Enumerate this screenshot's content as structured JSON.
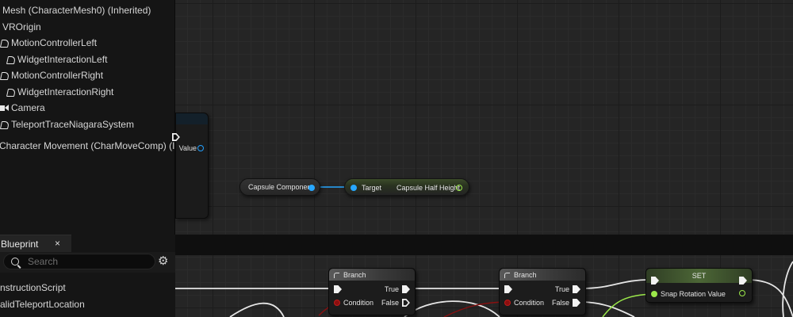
{
  "components": [
    {
      "label": "Mesh (CharacterMesh0) (Inherited)",
      "icon": "none"
    },
    {
      "label": "VROrigin",
      "icon": "none"
    },
    {
      "label": "MotionControllerLeft",
      "icon": "motion-controller-icon"
    },
    {
      "label": "WidgetInteractionLeft",
      "icon": "widget-interaction-icon"
    },
    {
      "label": "MotionControllerRight",
      "icon": "motion-controller-icon"
    },
    {
      "label": "WidgetInteractionRight",
      "icon": "widget-interaction-icon"
    },
    {
      "label": "Camera",
      "icon": "camera-icon"
    },
    {
      "label": "TeleportTraceNiagaraSystem",
      "icon": "niagara-icon"
    },
    {
      "label": "Character Movement (CharMoveComp) (Inh",
      "icon": "none"
    }
  ],
  "graph": {
    "partial_node": {
      "value_label": "Value"
    },
    "capsule_node": {
      "label": "Capsule Component"
    },
    "half_height_node": {
      "target_label": "Target",
      "output_label": "Capsule Half Height"
    },
    "branch_1": {
      "title": "Branch",
      "condition_label": "Condition",
      "true_label": "True",
      "false_label": "False"
    },
    "branch_2": {
      "title": "Branch",
      "condition_label": "Condition",
      "true_label": "True",
      "false_label": "False"
    },
    "set_node": {
      "title": "SET",
      "value_label": "Snap Rotation Value"
    }
  },
  "my_blueprint": {
    "tab_label": "Blueprint",
    "close_label": "×",
    "search_placeholder": "Search",
    "items": [
      "nstructionScript",
      "alidTeleportLocation"
    ]
  },
  "colors": {
    "exec": "#f2f2f2",
    "object_pin": "#27a7ff",
    "float_pin": "#9be84a",
    "bool_pin": "#c21a1a"
  }
}
